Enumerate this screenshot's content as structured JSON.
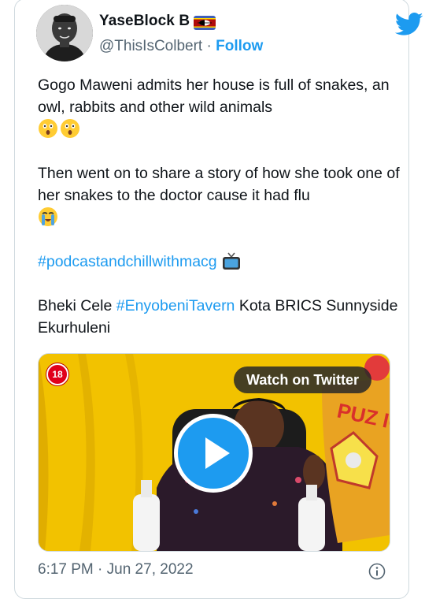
{
  "author": {
    "display_name": "YaseBlock B",
    "handle": "@ThisIsColbert",
    "separator": "·",
    "follow_label": "Follow",
    "flag_icon": "eswatini-flag-icon",
    "avatar_icon": "avatar"
  },
  "brand": {
    "logo_icon": "twitter-bird-icon",
    "color": "#1d9bf0"
  },
  "tweet": {
    "line1": "Gogo Maweni admits her house is full of snakes, an owl, rabbits and other wild animals",
    "line1_emojis": [
      "astonished-face-emoji",
      "astonished-face-emoji"
    ],
    "line2": "Then went on to share a story of how she took one of her snakes to the doctor cause it had flu",
    "line2_emojis": [
      "loudly-crying-face-emoji"
    ],
    "hashtag1": "#podcastandchillwithmacg",
    "hashtag1_emoji": "television-emoji",
    "line4_prefix": "Bheki Cele ",
    "hashtag2": "#EnyobeniTavern",
    "line4_suffix": " Kota BRICS Sunnyside Ekurhuleni"
  },
  "media": {
    "age_badge": "18",
    "watch_label": "Watch on Twitter",
    "play_icon": "play-icon",
    "background_color": "#f2c200",
    "poster_text": "PUZ ICE"
  },
  "footer": {
    "timestamp": "6:17 PM · Jun 27, 2022",
    "info_icon": "info-icon"
  }
}
